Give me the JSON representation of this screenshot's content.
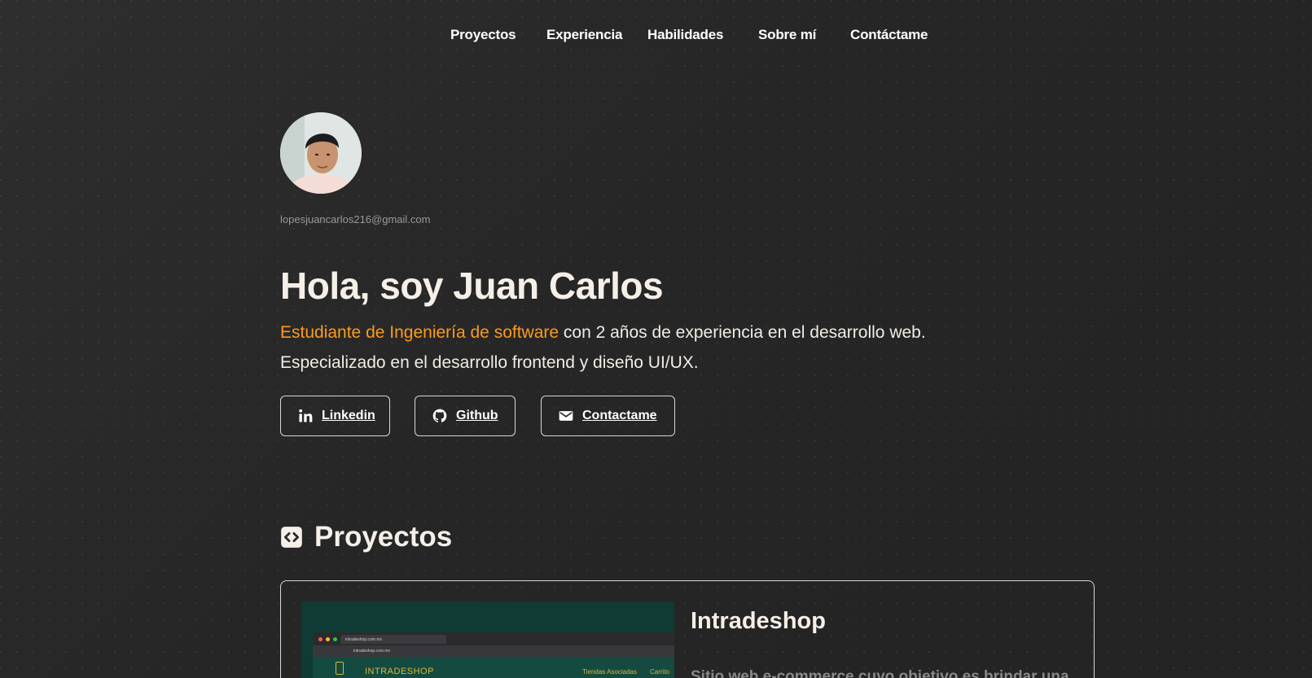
{
  "nav": {
    "items": [
      {
        "label": "Proyectos"
      },
      {
        "label": "Experiencia"
      },
      {
        "label": "Habilidades"
      },
      {
        "label": "Sobre mí"
      },
      {
        "label": "Contáctame"
      }
    ]
  },
  "profile": {
    "email": "lopesjuancarlos216@gmail.com"
  },
  "hero": {
    "title": "Hola, soy Juan Carlos",
    "highlight": "Estudiante de Ingeniería de software",
    "desc_line1_rest": " con 2 años de experiencia en el desarrollo web.",
    "desc_line2": "Especializado en el desarrollo frontend y diseño UI/UX."
  },
  "buttons": {
    "linkedin": "Linkedin",
    "github": "Github",
    "contact": "Contactame"
  },
  "projects": {
    "title": "Proyectos",
    "items": [
      {
        "name": "Intradeshop",
        "desc": "Sitio web e-commerce cuyo objetivo es brindar una",
        "thumb": {
          "tab": "intradeshop.com.mx",
          "url": "intradeshop.com.mx",
          "brand": "INTRADESHOP",
          "link1": "Tiendas Asociadas",
          "link2": "Carrito"
        }
      }
    ]
  },
  "colors": {
    "accent": "#ff9a1a",
    "background": "#2a2a2a",
    "text": "#f2ece6"
  }
}
